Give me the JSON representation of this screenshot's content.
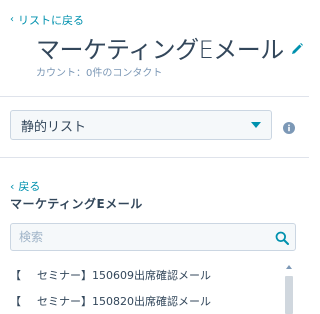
{
  "header": {
    "back_label": "リストに戻る",
    "title": "マーケティングEメール",
    "subtitle": "カウント：0件のコンタクト"
  },
  "list_type_select": {
    "value": "静的リスト"
  },
  "panel": {
    "back_label": "戻る",
    "title": "マーケティングEメール",
    "search_placeholder": "検索",
    "items": [
      {
        "prefix": "【",
        "label": "セミナー】150609出席確認メール"
      },
      {
        "prefix": "【",
        "label": "セミナー】150820出席確認メール"
      }
    ]
  },
  "colors": {
    "accent": "#0091ae",
    "text": "#33475b",
    "muted": "#7c98b6",
    "border": "#cbd6e2",
    "field_bg": "#f5f8fa"
  },
  "icons": {
    "edit": "pencil-icon",
    "search": "search-icon",
    "info": "info-icon",
    "dropdown": "caret-down-icon"
  }
}
